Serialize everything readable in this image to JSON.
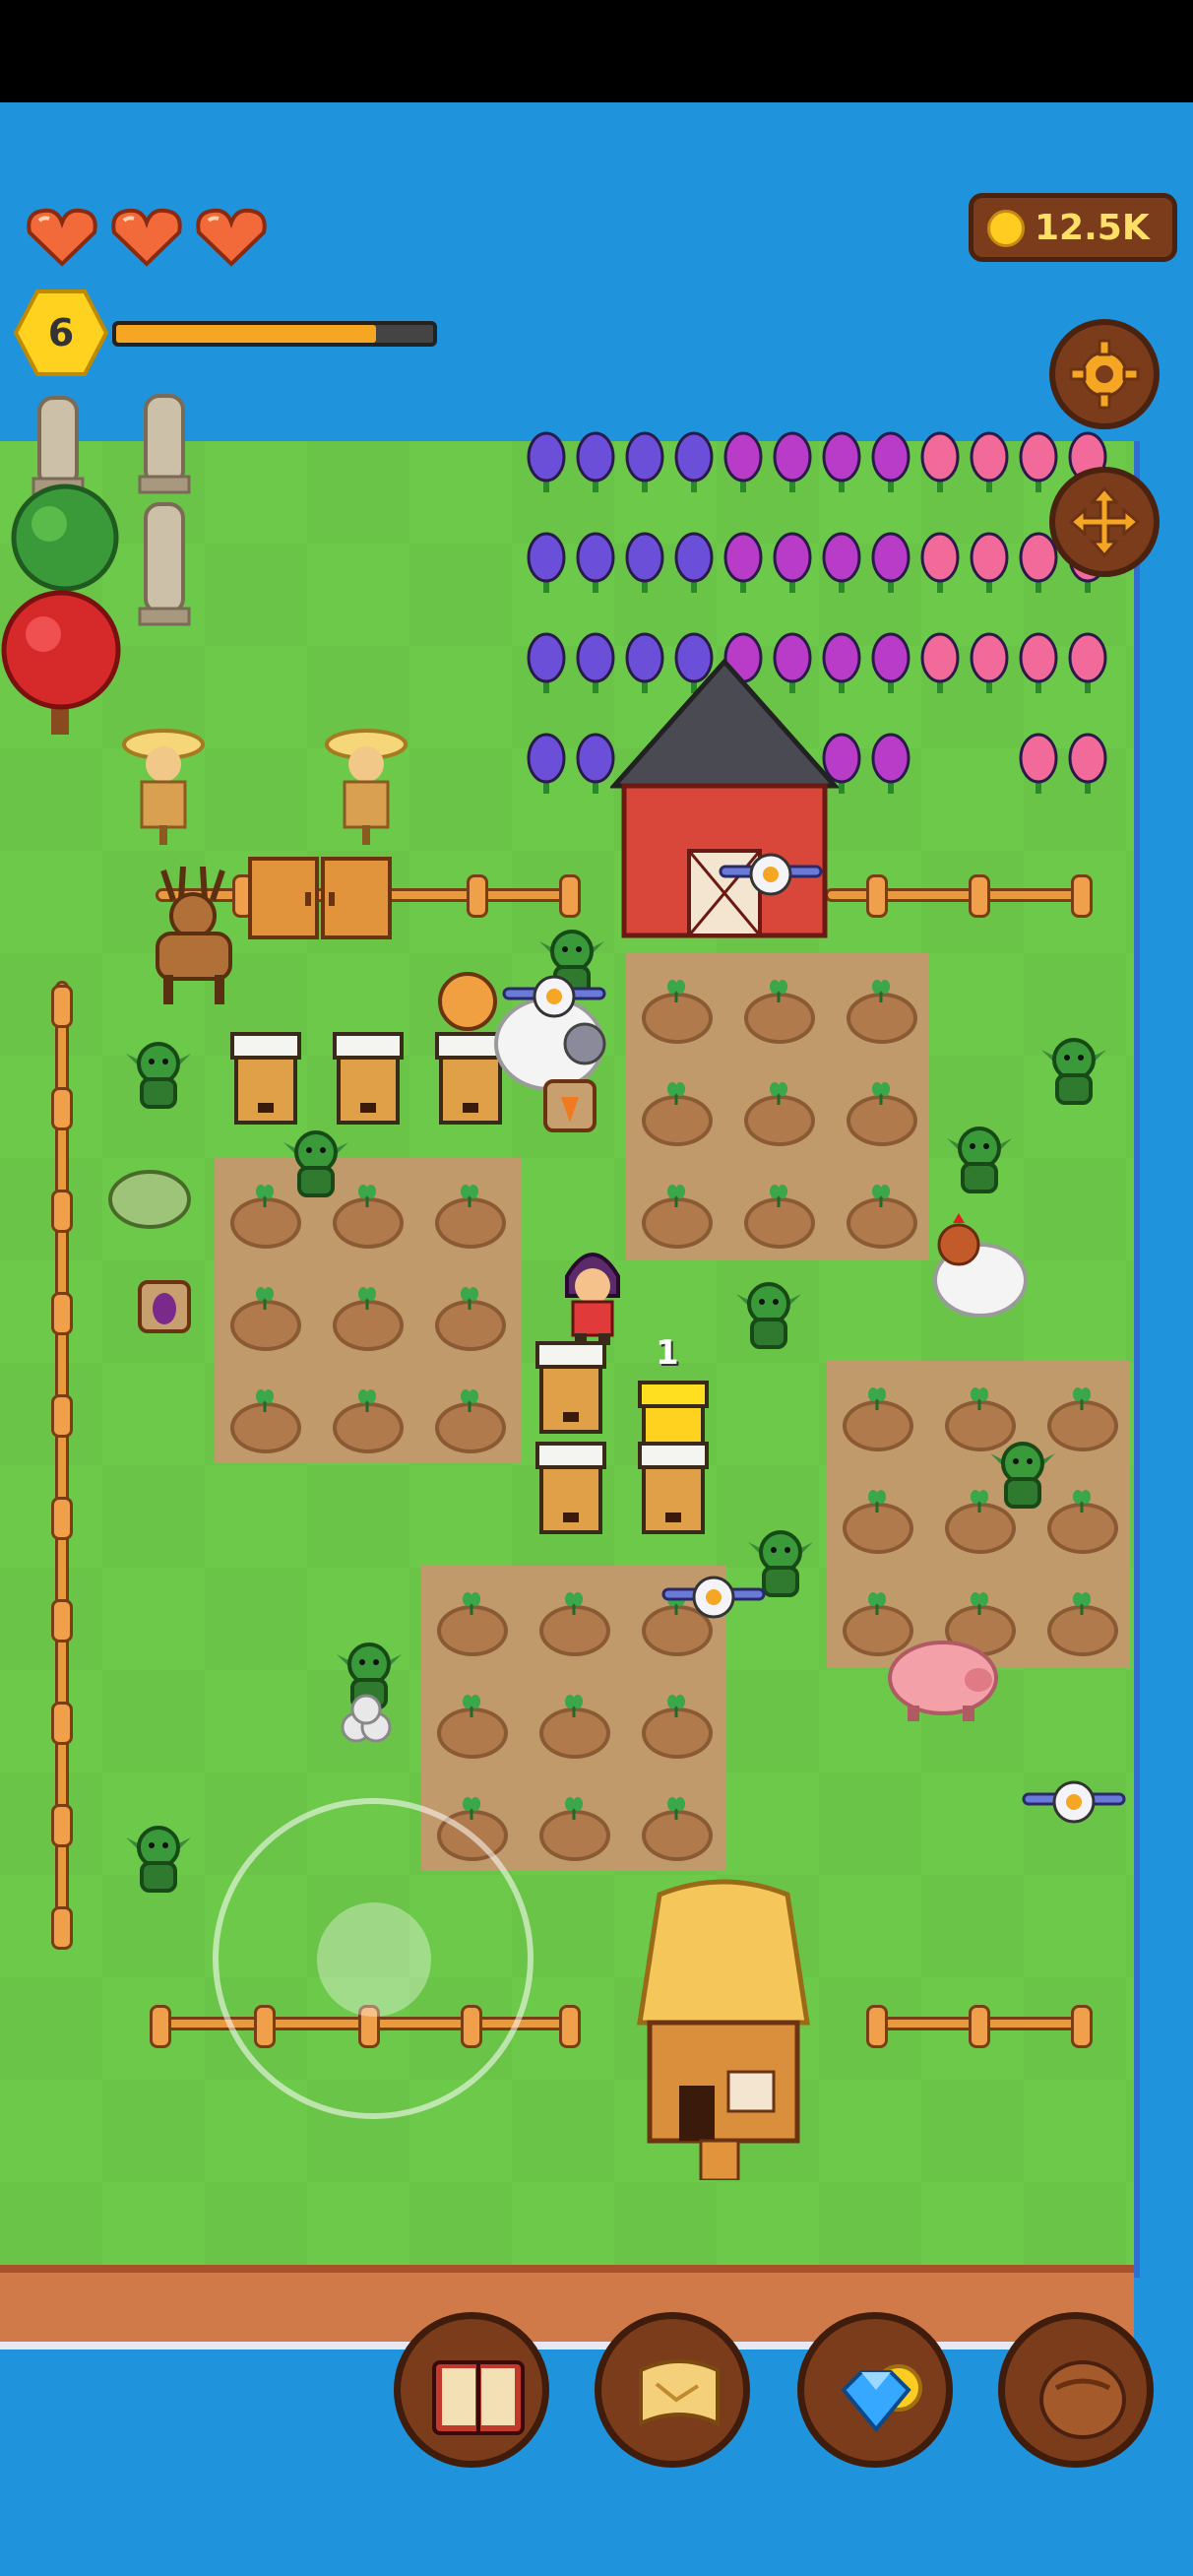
{
  "hud": {
    "hearts": {
      "count": 3,
      "icon": "heart-icon",
      "color": "#f26a3a"
    },
    "level": {
      "value": "6"
    },
    "xp": {
      "progress": 0.82
    },
    "coins": {
      "value": "12.5K",
      "icon": "coin-icon"
    }
  },
  "side_buttons": [
    {
      "name": "settings-button",
      "icon": "gear-icon"
    },
    {
      "name": "move-button",
      "icon": "move-arrows-icon"
    }
  ],
  "toolbar": [
    {
      "name": "book-button",
      "icon": "open-book-icon"
    },
    {
      "name": "map-button",
      "icon": "scroll-map-icon"
    },
    {
      "name": "shop-button",
      "icon": "gem-coin-icon"
    },
    {
      "name": "inventory-button",
      "icon": "leather-bag-icon"
    }
  ],
  "world": {
    "quantity_badge": "1",
    "colors": {
      "grass": "#6dc94a",
      "water": "#1f93dc",
      "soil": "#c09a6a",
      "fence": "#e89a3c",
      "accent_gold": "#f5a623"
    }
  }
}
